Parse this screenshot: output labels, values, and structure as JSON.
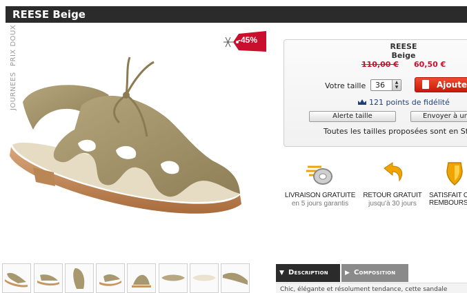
{
  "product": {
    "title": "REESE Beige"
  },
  "brand_vertical": {
    "line1": "JOURNEES",
    "line2": "PRIX DOUX"
  },
  "discount": {
    "label": "-45%",
    "color": "#c8102e"
  },
  "buybox": {
    "name": "REESE",
    "color": "Beige",
    "old_price": "110,00 €",
    "new_price": "60,50 €",
    "size_label": "Votre taille",
    "size_value": "36",
    "add_button": "Ajouter",
    "points": "121 points de fidélité",
    "alert_button": "Alerte taille",
    "send_button": "Envoyer à un ami",
    "sizes_info": "Toutes les tailles proposées sont en Stock"
  },
  "benefits": [
    {
      "title": "LIVRAISON GRATUITE",
      "subtitle": "en 5 jours garantis",
      "icon": "truck-wheel-icon"
    },
    {
      "title": "RETOUR GRATUIT",
      "subtitle": "jusqu'à 30 jours",
      "icon": "return-arrow-icon"
    },
    {
      "title": "SATISFAIT OU",
      "subtitle": "REMBOURSÉ",
      "icon": "shield-icon"
    }
  ],
  "thumbnails": 8,
  "tabs": {
    "description": "Description",
    "composition": "Composition"
  },
  "description_text": "Chic, élégante et résolument tendance, cette sandale"
}
